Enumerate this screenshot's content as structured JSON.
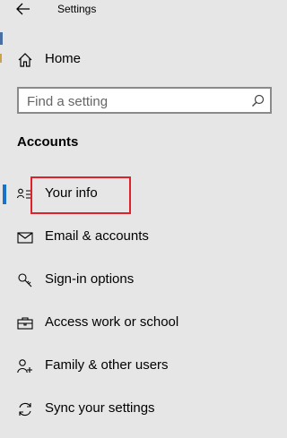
{
  "window": {
    "title": "Settings"
  },
  "nav": {
    "home_label": "Home",
    "search_placeholder": "Find a setting",
    "section_title": "Accounts",
    "items": [
      {
        "label": "Your info",
        "icon": "person-card-icon",
        "selected": true
      },
      {
        "label": "Email & accounts",
        "icon": "envelope-icon"
      },
      {
        "label": "Sign-in options",
        "icon": "key-icon"
      },
      {
        "label": "Access work or school",
        "icon": "briefcase-icon"
      },
      {
        "label": "Family & other users",
        "icon": "add-person-icon"
      },
      {
        "label": "Sync your settings",
        "icon": "sync-icon"
      }
    ]
  },
  "colors": {
    "accent": "#1a73c9",
    "annotation": "#e0202b",
    "background": "#e6e6e6"
  }
}
